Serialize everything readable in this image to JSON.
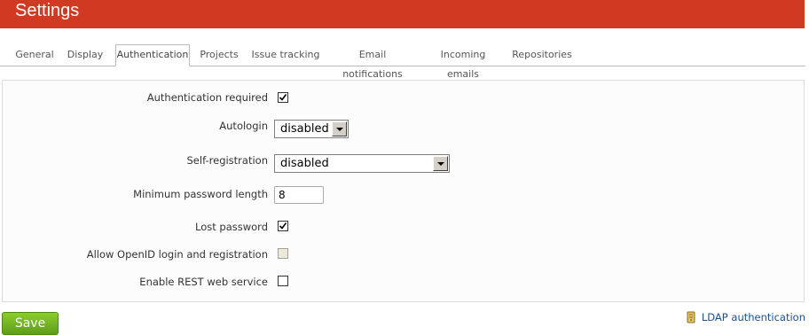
{
  "header": {
    "title": "Settings"
  },
  "tabs": [
    {
      "label": "General"
    },
    {
      "label": "Display"
    },
    {
      "label": "Authentication"
    },
    {
      "label": "Projects"
    },
    {
      "label": "Issue tracking"
    },
    {
      "label": "Email notifications"
    },
    {
      "label": "Incoming emails"
    },
    {
      "label": "Repositories"
    }
  ],
  "selected_tab": "Authentication",
  "form": {
    "auth_required": {
      "label": "Authentication required",
      "checked": true
    },
    "autologin": {
      "label": "Autologin",
      "value": "disabled"
    },
    "self_registration": {
      "label": "Self-registration",
      "value": "disabled"
    },
    "min_password_length": {
      "label": "Minimum password length",
      "value": "8"
    },
    "lost_password": {
      "label": "Lost password",
      "checked": true
    },
    "openid": {
      "label": "Allow OpenID login and registration",
      "checked": false,
      "disabled": true
    },
    "rest": {
      "label": "Enable REST web service",
      "checked": false
    }
  },
  "actions": {
    "save_label": "Save"
  },
  "links": {
    "ldap_label": "LDAP authentication"
  },
  "colors": {
    "header_bg": "#d13a22",
    "save_green": "#6aaa1e",
    "link_blue": "#1b4f93"
  },
  "icons": {
    "ldap": "server-icon",
    "check": "check-icon"
  }
}
